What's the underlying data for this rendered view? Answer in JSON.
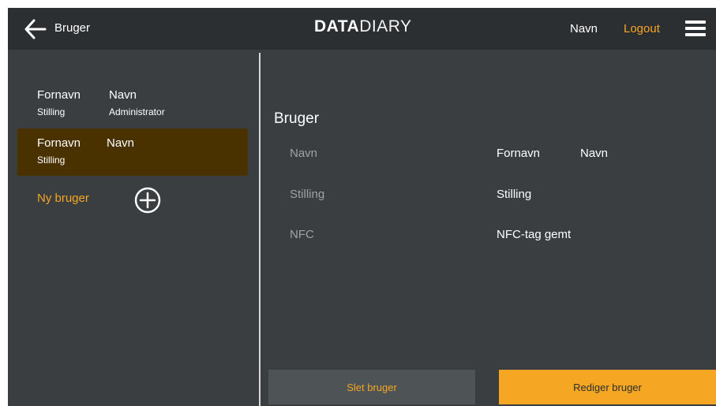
{
  "header": {
    "title": "Bruger",
    "logo_bold": "DATA",
    "logo_light": "DIARY",
    "user_name": "Navn",
    "logout_label": "Logout",
    "back_icon": "arrow-left-icon",
    "menu_icon": "hamburger-menu-icon"
  },
  "sidebar": {
    "users": [
      {
        "first_name": "Fornavn",
        "last_name": "Navn",
        "position": "Stilling",
        "role": "Administrator",
        "selected": false
      },
      {
        "first_name": "Fornavn",
        "last_name": "Navn",
        "position": "Stilling",
        "role": "",
        "selected": true
      }
    ],
    "new_user_label": "Ny bruger",
    "add_icon": "plus-circle-icon"
  },
  "detail": {
    "title": "Bruger",
    "fields": [
      {
        "label": "Navn",
        "value_first": "Fornavn",
        "value_last": "Navn"
      },
      {
        "label": "Stilling",
        "value": "Stilling"
      },
      {
        "label": "NFC",
        "value": "NFC-tag gemt"
      }
    ]
  },
  "actions": {
    "delete_label": "Slet bruger",
    "edit_label": "Rediger bruger"
  },
  "colors": {
    "background": "#3a3e41",
    "header": "#2c2f31",
    "accent": "#f5a623",
    "selected_row": "#4a3100",
    "muted_label": "#9ea2a5"
  }
}
